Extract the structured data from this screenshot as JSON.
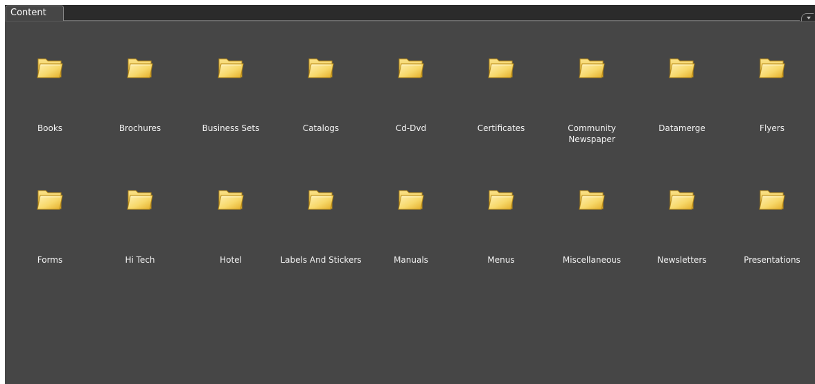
{
  "panel": {
    "tab_label": "Content"
  },
  "folders": [
    {
      "label": "Books"
    },
    {
      "label": "Brochures"
    },
    {
      "label": "Business Sets"
    },
    {
      "label": "Catalogs"
    },
    {
      "label": "Cd-Dvd"
    },
    {
      "label": "Certificates"
    },
    {
      "label": "Community Newspaper"
    },
    {
      "label": "Datamerge"
    },
    {
      "label": "Flyers"
    },
    {
      "label": "Forms"
    },
    {
      "label": "Hi Tech"
    },
    {
      "label": "Hotel"
    },
    {
      "label": "Labels And Stickers"
    },
    {
      "label": "Manuals"
    },
    {
      "label": "Menus"
    },
    {
      "label": "Miscellaneous"
    },
    {
      "label": "Newsletters"
    },
    {
      "label": "Presentations"
    }
  ],
  "icons": {
    "folder": "folder-icon",
    "panel_menu": "panel-menu-icon"
  },
  "colors": {
    "background": "#464646",
    "tab_bar": "#2b2b2b",
    "folder_fill": "#f7d86a",
    "folder_edge": "#b78a1a"
  }
}
